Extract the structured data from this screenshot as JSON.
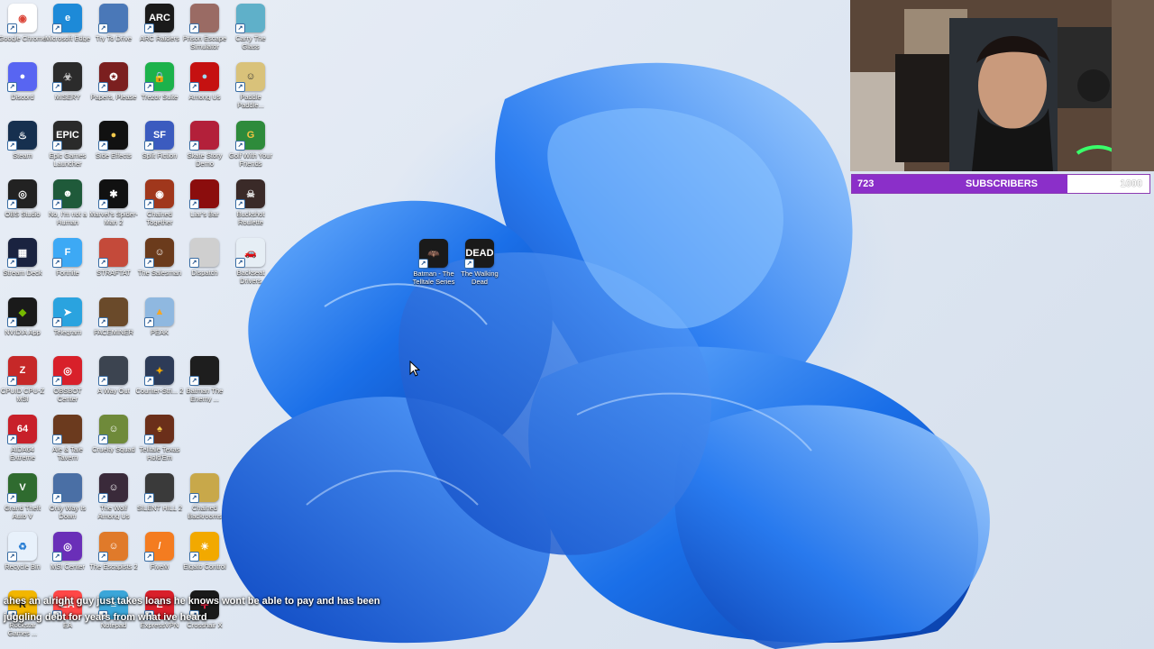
{
  "colors": {
    "accent_purple": "#8b2fc9",
    "wallpaper_blue": "#1a6fe8"
  },
  "desktop": {
    "icons": [
      {
        "label": "Google Chrome",
        "icon": "chrome-icon",
        "bg": "#ffffff",
        "glyph": "◉",
        "fg": "#db4437",
        "col": 0,
        "row": 0
      },
      {
        "label": "Microsoft Edge",
        "icon": "edge-icon",
        "bg": "#1d8ad8",
        "glyph": "e",
        "fg": "#fff",
        "col": 1,
        "row": 0
      },
      {
        "label": "Try To Drive",
        "icon": "game-icon",
        "bg": "#4a78b8",
        "glyph": "",
        "fg": "#fff",
        "col": 2,
        "row": 0
      },
      {
        "label": "ARC Raiders",
        "icon": "arc-raiders-icon",
        "bg": "#1a1a1a",
        "glyph": "ARC",
        "fg": "#fff",
        "col": 3,
        "row": 0
      },
      {
        "label": "Prison Escape Simulator",
        "icon": "game-icon",
        "bg": "#9a6b64",
        "glyph": "",
        "fg": "#fff",
        "col": 4,
        "row": 0
      },
      {
        "label": "Carry The Glass",
        "icon": "game-icon",
        "bg": "#5fb0c9",
        "glyph": "",
        "fg": "#fff",
        "col": 5,
        "row": 0
      },
      {
        "label": "Discord",
        "icon": "discord-icon",
        "bg": "#5865f2",
        "glyph": "●",
        "fg": "#fff",
        "col": 0,
        "row": 1
      },
      {
        "label": "MISERY",
        "icon": "game-icon",
        "bg": "#2b2b2b",
        "glyph": "☣",
        "fg": "#ccc",
        "col": 1,
        "row": 1
      },
      {
        "label": "Papers, Please",
        "icon": "game-icon",
        "bg": "#7b1f1f",
        "glyph": "✪",
        "fg": "#fff",
        "col": 2,
        "row": 1
      },
      {
        "label": "Trezor Suite",
        "icon": "lock-icon",
        "bg": "#1cb24b",
        "glyph": "🔒",
        "fg": "#fff",
        "col": 3,
        "row": 1
      },
      {
        "label": "Among Us",
        "icon": "game-icon",
        "bg": "#c51111",
        "glyph": "●",
        "fg": "#9fd9ee",
        "col": 4,
        "row": 1
      },
      {
        "label": "Paddle Paddle...",
        "icon": "game-icon",
        "bg": "#d9c27a",
        "glyph": "☺",
        "fg": "#333",
        "col": 5,
        "row": 1
      },
      {
        "label": "Steam",
        "icon": "steam-icon",
        "bg": "#16304f",
        "glyph": "♨",
        "fg": "#fff",
        "col": 0,
        "row": 2
      },
      {
        "label": "Epic Games Launcher",
        "icon": "epic-icon",
        "bg": "#2a2a2a",
        "glyph": "EPIC",
        "fg": "#fff",
        "col": 1,
        "row": 2
      },
      {
        "label": "Side Effects",
        "icon": "game-icon",
        "bg": "#111111",
        "glyph": "●",
        "fg": "#f2c94c",
        "col": 2,
        "row": 2
      },
      {
        "label": "Split Fiction",
        "icon": "game-icon",
        "bg": "#3b5bbf",
        "glyph": "SF",
        "fg": "#fff",
        "col": 3,
        "row": 2
      },
      {
        "label": "Skate Story Demo",
        "icon": "game-icon",
        "bg": "#b3203a",
        "glyph": "",
        "fg": "#fff",
        "col": 4,
        "row": 2
      },
      {
        "label": "Golf With Your Friends",
        "icon": "game-icon",
        "bg": "#2e8b3b",
        "glyph": "G",
        "fg": "#f5c542",
        "col": 5,
        "row": 2
      },
      {
        "label": "OBS Studio",
        "icon": "obs-icon",
        "bg": "#222222",
        "glyph": "◎",
        "fg": "#fff",
        "col": 0,
        "row": 3
      },
      {
        "label": "No, I'm not a Human",
        "icon": "game-icon",
        "bg": "#1f5a3a",
        "glyph": "☻",
        "fg": "#fff",
        "col": 1,
        "row": 3
      },
      {
        "label": "Marvel's Spider-Man 2",
        "icon": "spider-icon",
        "bg": "#111111",
        "glyph": "✱",
        "fg": "#fff",
        "col": 2,
        "row": 3
      },
      {
        "label": "Chained Together",
        "icon": "game-icon",
        "bg": "#a0371c",
        "glyph": "◉",
        "fg": "#fff",
        "col": 3,
        "row": 3
      },
      {
        "label": "Liar's Bar",
        "icon": "game-icon",
        "bg": "#8b0d0d",
        "glyph": "",
        "fg": "#fff",
        "col": 4,
        "row": 3
      },
      {
        "label": "Buckshot Roulette",
        "icon": "game-icon",
        "bg": "#3a2a28",
        "glyph": "☠",
        "fg": "#e6e6e6",
        "col": 5,
        "row": 3
      },
      {
        "label": "Stream Deck",
        "icon": "stream-deck-icon",
        "bg": "#1a2340",
        "glyph": "▦",
        "fg": "#fff",
        "col": 0,
        "row": 4
      },
      {
        "label": "Fortnite",
        "icon": "fortnite-icon",
        "bg": "#3da9f5",
        "glyph": "F",
        "fg": "#fff",
        "col": 1,
        "row": 4
      },
      {
        "label": "STRAFTAT",
        "icon": "game-icon",
        "bg": "#c44a3a",
        "glyph": "",
        "fg": "#fff",
        "col": 2,
        "row": 4
      },
      {
        "label": "The Salesman",
        "icon": "game-icon",
        "bg": "#6b3b1c",
        "glyph": "☺",
        "fg": "#fff",
        "col": 3,
        "row": 4
      },
      {
        "label": "Dispatch",
        "icon": "game-icon",
        "bg": "#cfcfcf",
        "glyph": "",
        "fg": "#333",
        "col": 4,
        "row": 4
      },
      {
        "label": "Backseat Drivers",
        "icon": "car-icon",
        "bg": "#e6eef5",
        "glyph": "🚗",
        "fg": "#c00",
        "col": 5,
        "row": 4
      },
      {
        "label": "NVIDIA App",
        "icon": "nvidia-icon",
        "bg": "#1a1a1a",
        "glyph": "◆",
        "fg": "#76b900",
        "col": 0,
        "row": 5
      },
      {
        "label": "Telegram",
        "icon": "telegram-icon",
        "bg": "#2aa3df",
        "glyph": "➤",
        "fg": "#fff",
        "col": 1,
        "row": 5
      },
      {
        "label": "FACEMINER",
        "icon": "game-icon",
        "bg": "#6a4a2a",
        "glyph": "",
        "fg": "#fff",
        "col": 2,
        "row": 5
      },
      {
        "label": "PEAK",
        "icon": "mountain-icon",
        "bg": "#8fb8e0",
        "glyph": "▲",
        "fg": "#f5a623",
        "col": 3,
        "row": 5
      },
      {
        "label": "CPUID CPU-Z MSI",
        "icon": "cpu-icon",
        "bg": "#c62828",
        "glyph": "Z",
        "fg": "#fff",
        "col": 0,
        "row": 6
      },
      {
        "label": "OBSBOT Center",
        "icon": "camera-icon",
        "bg": "#d8202a",
        "glyph": "◎",
        "fg": "#fff",
        "col": 1,
        "row": 6
      },
      {
        "label": "A Way Out",
        "icon": "game-icon",
        "bg": "#3c4450",
        "glyph": "",
        "fg": "#fff",
        "col": 2,
        "row": 6
      },
      {
        "label": "Counter-Stri... 2",
        "icon": "cs2-icon",
        "bg": "#2d3b57",
        "glyph": "✦",
        "fg": "#f2a900",
        "col": 3,
        "row": 6
      },
      {
        "label": "Batman The Enemy ...",
        "icon": "game-icon",
        "bg": "#1e1e1e",
        "glyph": "",
        "fg": "#fff",
        "col": 4,
        "row": 6
      },
      {
        "label": "AIDA64 Extreme",
        "icon": "aida-icon",
        "bg": "#c8202a",
        "glyph": "64",
        "fg": "#fff",
        "col": 0,
        "row": 7
      },
      {
        "label": "Ale & Tale Tavern",
        "icon": "game-icon",
        "bg": "#6b3a1e",
        "glyph": "",
        "fg": "#fff",
        "col": 1,
        "row": 7
      },
      {
        "label": "Cruelty Squad",
        "icon": "game-icon",
        "bg": "#6f8a3a",
        "glyph": "☺",
        "fg": "#fff",
        "col": 2,
        "row": 7
      },
      {
        "label": "Telltale Texas Hold'Em",
        "icon": "game-icon",
        "bg": "#6b2f1a",
        "glyph": "♠",
        "fg": "#f2c94c",
        "col": 3,
        "row": 7
      },
      {
        "label": "Grand Theft Auto V",
        "icon": "gta-icon",
        "bg": "#2f6b2f",
        "glyph": "V",
        "fg": "#fff",
        "col": 0,
        "row": 8
      },
      {
        "label": "Only Way Is Down",
        "icon": "game-icon",
        "bg": "#4a6fa5",
        "glyph": "",
        "fg": "#fff",
        "col": 1,
        "row": 8
      },
      {
        "label": "The Wolf Among Us",
        "icon": "game-icon",
        "bg": "#3a2a3a",
        "glyph": "☺",
        "fg": "#fff",
        "col": 2,
        "row": 8
      },
      {
        "label": "SILENT HILL 2",
        "icon": "game-icon",
        "bg": "#3a3a3a",
        "glyph": "",
        "fg": "#fff",
        "col": 3,
        "row": 8
      },
      {
        "label": "Chained Backrooms",
        "icon": "game-icon",
        "bg": "#c8a84a",
        "glyph": "",
        "fg": "#333",
        "col": 4,
        "row": 8
      },
      {
        "label": "Recycle Bin",
        "icon": "recycle-bin-icon",
        "bg": "#e8f1fb",
        "glyph": "♻",
        "fg": "#2a7fd4",
        "col": 0,
        "row": 9
      },
      {
        "label": "MSI Center",
        "icon": "msi-icon",
        "bg": "#6a2fb8",
        "glyph": "◎",
        "fg": "#fff",
        "col": 1,
        "row": 9
      },
      {
        "label": "The Escapists 2",
        "icon": "game-icon",
        "bg": "#e07a2a",
        "glyph": "☺",
        "fg": "#fff",
        "col": 2,
        "row": 9
      },
      {
        "label": "FiveM",
        "icon": "fivem-icon",
        "bg": "#f47c20",
        "glyph": "/",
        "fg": "#fff",
        "col": 3,
        "row": 9
      },
      {
        "label": "Elgato Control",
        "icon": "elgato-icon",
        "bg": "#f2a900",
        "glyph": "☀",
        "fg": "#fff",
        "col": 4,
        "row": 9
      },
      {
        "label": "Rockstar Games ...",
        "icon": "rockstar-icon",
        "bg": "#f2b600",
        "glyph": "R",
        "fg": "#222",
        "col": 0,
        "row": 10
      },
      {
        "label": "EA",
        "icon": "ea-icon",
        "bg": "#ff4747",
        "glyph": "EA",
        "fg": "#fff",
        "col": 1,
        "row": 10
      },
      {
        "label": "Notepad",
        "icon": "notepad-icon",
        "bg": "#3ba6d9",
        "glyph": "≡",
        "fg": "#fff",
        "col": 2,
        "row": 10
      },
      {
        "label": "ExpressVPN",
        "icon": "vpn-icon",
        "bg": "#d91f2a",
        "glyph": "E",
        "fg": "#fff",
        "col": 3,
        "row": 10
      },
      {
        "label": "Crosshair X",
        "icon": "crosshair-icon",
        "bg": "#1a1a1a",
        "glyph": "✛",
        "fg": "#f24",
        "col": 4,
        "row": 10
      }
    ],
    "center_icons": [
      {
        "label": "Batman - The Telltale Series",
        "icon": "batman-icon",
        "bg": "#1a1a1a",
        "glyph": "🦇",
        "fg": "#fff",
        "pos": "left"
      },
      {
        "label": "The Walking Dead",
        "icon": "walking-dead-icon",
        "bg": "#1a1a1a",
        "glyph": "DEAD",
        "fg": "#fff",
        "pos": "right"
      }
    ]
  },
  "overlay": {
    "subscribers": {
      "current": "723",
      "label": "SUBSCRIBERS",
      "goal": "1000",
      "progress_fraction": 0.723
    },
    "chat_message": "hes an alright guy just takes loans he knows wont be able to pay and has been juggling debt for years from what ive heard",
    "chat_prefix": "a"
  }
}
